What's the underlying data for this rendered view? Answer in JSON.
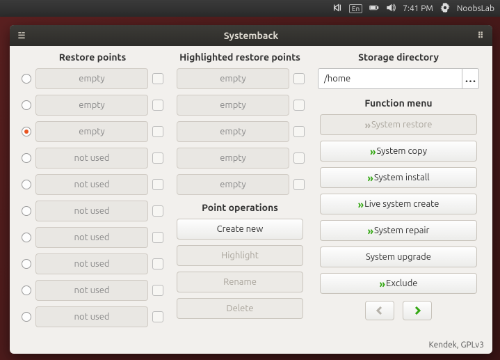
{
  "topbar": {
    "lang": "En",
    "time": "7:41 PM",
    "user": "NoobsLab"
  },
  "window": {
    "title": "Systemback"
  },
  "cols": {
    "restore": "Restore points",
    "highlighted": "Highlighted restore points",
    "storage": "Storage directory"
  },
  "restore_points": [
    {
      "label": "empty",
      "selected": false
    },
    {
      "label": "empty",
      "selected": false
    },
    {
      "label": "empty",
      "selected": true
    },
    {
      "label": "not used",
      "selected": false
    },
    {
      "label": "not used",
      "selected": false
    },
    {
      "label": "not used",
      "selected": false
    },
    {
      "label": "not used",
      "selected": false
    },
    {
      "label": "not used",
      "selected": false
    },
    {
      "label": "not used",
      "selected": false
    },
    {
      "label": "not used",
      "selected": false
    }
  ],
  "highlighted_points": [
    {
      "label": "empty"
    },
    {
      "label": "empty"
    },
    {
      "label": "empty"
    },
    {
      "label": "empty"
    },
    {
      "label": "empty"
    }
  ],
  "storage_path": "/home",
  "function_menu_title": "Function menu",
  "functions": {
    "restore": "System restore",
    "copy": "System copy",
    "install": "System install",
    "live": "Live system create",
    "repair": "System repair",
    "upgrade": "System upgrade",
    "exclude": "Exclude"
  },
  "point_ops_title": "Point operations",
  "point_ops": {
    "create": "Create new",
    "highlight": "Highlight",
    "rename": "Rename",
    "delete": "Delete"
  },
  "footer": "Kendek, GPLv3"
}
